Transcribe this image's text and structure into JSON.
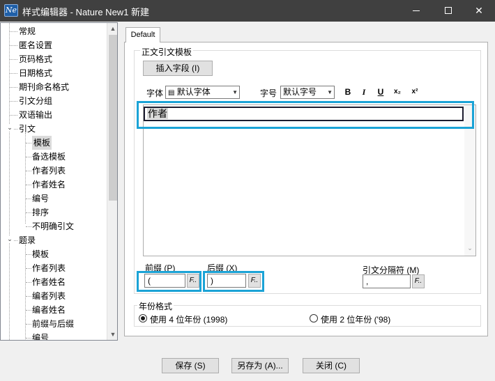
{
  "window": {
    "app_icon": "Ne",
    "title": "样式编辑器 - Nature New1  新建"
  },
  "tree": {
    "items": [
      {
        "label": "常规"
      },
      {
        "label": "匿名设置"
      },
      {
        "label": "页码格式"
      },
      {
        "label": "日期格式"
      },
      {
        "label": "期刊命名格式"
      },
      {
        "label": "引文分组"
      },
      {
        "label": "双语输出"
      },
      {
        "label": "引文",
        "expander": "⌄"
      },
      {
        "label": "模板",
        "selected": true
      },
      {
        "label": "备选模板"
      },
      {
        "label": "作者列表"
      },
      {
        "label": "作者姓名"
      },
      {
        "label": "编号"
      },
      {
        "label": "排序"
      },
      {
        "label": "不明确引文"
      },
      {
        "label": "题录",
        "expander": "⌄"
      },
      {
        "label": "模板"
      },
      {
        "label": "作者列表"
      },
      {
        "label": "作者姓名"
      },
      {
        "label": "编者列表"
      },
      {
        "label": "编者姓名"
      },
      {
        "label": "前缀与后缀"
      },
      {
        "label": "编号"
      }
    ]
  },
  "tab": {
    "label": "Default"
  },
  "template_group": {
    "label": "正文引文模板",
    "insert_field_button": "插入字段 (I)",
    "font_label": "字体",
    "font_value": "默认字体",
    "size_label": "字号",
    "size_value": "默认字号",
    "format_buttons": {
      "bold": "B",
      "italic": "I",
      "underline": "U",
      "subscript": "x₂",
      "superscript": "x²"
    },
    "field_token": "作者"
  },
  "affixes": {
    "prefix_label": "前缀 (P)",
    "prefix_value": "(",
    "suffix_label": "后缀 (X)",
    "suffix_value": ")",
    "separator_label": "引文分隔符 (M)",
    "separator_value": ",",
    "field_button": "F.."
  },
  "year_format": {
    "label": "年份格式",
    "option_4digit": "使用 4 位年份 (1998)",
    "option_2digit": "使用 2 位年份 ('98)",
    "selected": "4digit"
  },
  "footer": {
    "save": "保存 (S)",
    "save_as": "另存为 (A)...",
    "close": "关闭 (C)"
  },
  "colors": {
    "titlebar": "#404040",
    "highlight": "#1ba3d6",
    "selection": "#dadada"
  }
}
